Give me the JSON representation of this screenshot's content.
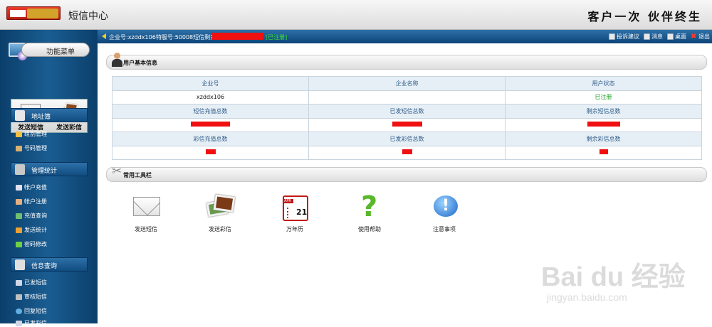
{
  "header": {
    "app_title": "短信中心",
    "slogan": "客户一次 伙伴终生"
  },
  "infobar": {
    "company_label": "企业号:xzddx106",
    "special_label": "特服号:50008短信剩余",
    "status_text": "[已注册]",
    "links": [
      {
        "label": "投诉建议",
        "icon": "feedback-icon"
      },
      {
        "label": "消息",
        "icon": "message-icon"
      },
      {
        "label": "桌面",
        "icon": "home-icon"
      },
      {
        "label": "退出",
        "icon": "close-icon"
      }
    ]
  },
  "sidebar": {
    "menu_title": "功能菜单",
    "quick": [
      {
        "label": "发送短信",
        "icon": "envelope-icon"
      },
      {
        "label": "发送彩信",
        "icon": "photos-icon"
      }
    ],
    "sections": [
      {
        "title": "地址簿",
        "icon": "address-book-icon",
        "items": [
          {
            "label": "组别管理",
            "icon": "folder-icon"
          },
          {
            "label": "号码管理",
            "icon": "contacts-icon"
          }
        ]
      },
      {
        "title": "管理统计",
        "icon": "tools-icon",
        "items": [
          {
            "label": "帐户充值",
            "icon": "account-icon"
          },
          {
            "label": "帐户注册",
            "icon": "register-icon"
          },
          {
            "label": "充值查询",
            "icon": "query-icon"
          },
          {
            "label": "发送统计",
            "icon": "pencil-icon"
          },
          {
            "label": "密码修改",
            "icon": "checkmark-icon"
          }
        ]
      },
      {
        "title": "信息查询",
        "icon": "book-icon",
        "items": [
          {
            "label": "已发短信",
            "icon": "sent-icon"
          },
          {
            "label": "审核短信",
            "icon": "review-icon"
          },
          {
            "label": "回复短信",
            "icon": "reply-icon"
          },
          {
            "label": "已发彩信",
            "icon": "sent-mms-icon"
          }
        ]
      }
    ]
  },
  "user_panel": {
    "title": "用户基本信息",
    "headers1": [
      "企业号",
      "企业名称",
      "用户状态"
    ],
    "values1": [
      "xzddx106",
      "",
      "已注册"
    ],
    "headers2": [
      "短信充值总数",
      "已发短信总数",
      "剩余短信总数"
    ],
    "headers3": [
      "彩信充值总数",
      "已发彩信总数",
      "剩余彩信总数"
    ]
  },
  "tools_panel": {
    "title": "常用工具栏",
    "tools": [
      {
        "label": "发送短信",
        "icon": "envelope-icon"
      },
      {
        "label": "发送彩信",
        "icon": "photos-icon"
      },
      {
        "label": "万年历",
        "icon": "calendar-icon"
      },
      {
        "label": "使用帮助",
        "icon": "help-icon"
      },
      {
        "label": "注意事项",
        "icon": "info-icon"
      }
    ],
    "calendar_month": "APR",
    "calendar_day": "21"
  },
  "watermark": {
    "brand": "Bai du 经验",
    "url": "jingyan.baidu.com"
  },
  "colors": {
    "accent_blue": "#0d4478",
    "status_green": "#1aa020",
    "redaction": "#f01010"
  }
}
